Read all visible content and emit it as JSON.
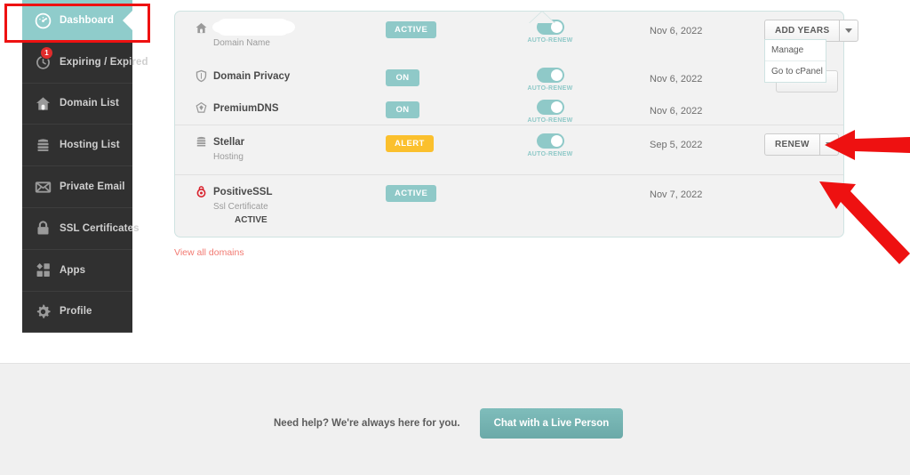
{
  "sidebar": {
    "items": [
      {
        "label": "Dashboard",
        "icon": "gauge-icon",
        "active": true,
        "badge": null
      },
      {
        "label": "Expiring / Expired",
        "icon": "clock-icon",
        "active": false,
        "badge": "1"
      },
      {
        "label": "Domain List",
        "icon": "house-icon",
        "active": false,
        "badge": null
      },
      {
        "label": "Hosting List",
        "icon": "server-icon",
        "active": false,
        "badge": null
      },
      {
        "label": "Private Email",
        "icon": "envelope-icon",
        "active": false,
        "badge": null
      },
      {
        "label": "SSL Certificates",
        "icon": "lock-icon",
        "active": false,
        "badge": null
      },
      {
        "label": "Apps",
        "icon": "apps-icon",
        "active": false,
        "badge": null
      },
      {
        "label": "Profile",
        "icon": "gear-icon",
        "active": false,
        "badge": null
      }
    ]
  },
  "card": {
    "groups": [
      {
        "rows": [
          {
            "name": "",
            "name_redacted": true,
            "sub": "Domain Name",
            "icon": "house-icon",
            "status": "ACTIVE",
            "status_kind": "active",
            "auto_renew_label": "AUTO-RENEW",
            "auto_renew_on": true,
            "date": "Nov 6, 2022",
            "action": {
              "label": "ADD YEARS",
              "caret": true
            }
          },
          {
            "name": "Domain Privacy",
            "sub": "",
            "icon": "shield-icon",
            "status": "ON",
            "status_kind": "on",
            "auto_renew_label": "AUTO-RENEW",
            "auto_renew_on": true,
            "date": "Nov 6, 2022",
            "action": null
          },
          {
            "name": "PremiumDNS",
            "sub": "",
            "icon": "dns-icon",
            "status": "ON",
            "status_kind": "on",
            "auto_renew_label": "AUTO-RENEW",
            "auto_renew_on": true,
            "date": "Nov 6, 2022",
            "action": null
          }
        ]
      },
      {
        "rows": [
          {
            "name": "Stellar",
            "sub": "Hosting",
            "icon": "server-icon",
            "status": "ALERT",
            "status_kind": "alert",
            "auto_renew_label": "AUTO-RENEW",
            "auto_renew_on": true,
            "date": "Sep 5, 2022",
            "action": {
              "label": "RENEW",
              "caret": true
            }
          }
        ]
      },
      {
        "rows": [
          {
            "name": "PositiveSSL",
            "sub": "Ssl Certificate",
            "sub2": "ACTIVE",
            "icon": "ssl-seal-icon",
            "status": "ACTIVE",
            "status_kind": "active",
            "auto_renew_label": "",
            "auto_renew_on": false,
            "date": "Nov 7, 2022",
            "action": null
          }
        ]
      }
    ],
    "dropdown": {
      "open": true,
      "items": [
        "Manage",
        "Go to cPanel"
      ]
    }
  },
  "links": {
    "view_all_domains": "View all domains"
  },
  "footer": {
    "help_text": "Need help? We're always here for you.",
    "chat_button": "Chat with a Live Person"
  },
  "colors": {
    "teal": "#8fcccb",
    "teal_pill": "#8fc9c8",
    "alert_yellow": "#fbc02d",
    "sidebar_dark": "#303030",
    "link_red": "#f27a72",
    "badge_red": "#e02c2c",
    "annotation_red": "#ee1111",
    "card_bg": "#f2f2f2",
    "footer_bg": "#f0f0f0"
  }
}
